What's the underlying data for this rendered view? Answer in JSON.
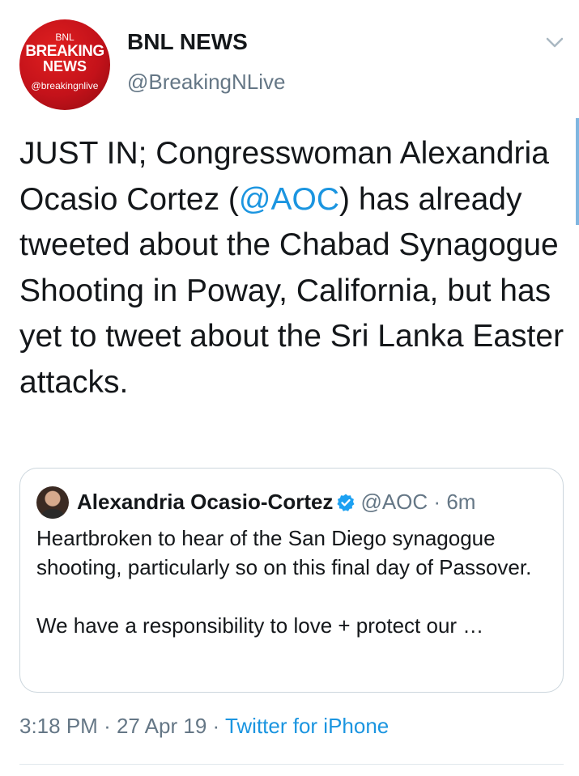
{
  "avatar": {
    "line1": "BNL",
    "line2": "BREAKING",
    "line3": "NEWS",
    "line4": "@breakingnlive",
    "color": "#c4121a"
  },
  "author": {
    "name": "BNL NEWS",
    "handle": "@BreakingNLive"
  },
  "caret_icon": "chevron-down-icon",
  "tweet": {
    "text_before": "JUST IN; Congresswoman Alexandria Ocasio Cortez (",
    "mention": "@AOC",
    "text_after": ") has already tweeted about the Chabad Synagogue Shooting in Poway, California, but has yet to tweet about the Sri Lanka Easter attacks."
  },
  "quote": {
    "name": "Alexandria Ocasio-Cortez",
    "verified_icon": "verified-badge-icon",
    "handle": "@AOC",
    "separator": "·",
    "time": "6m",
    "paragraph1": "Heartbroken to hear of the San Diego synagogue shooting, particularly so on this final day of Passover.",
    "paragraph2": "We have a responsibility to love + protect our …"
  },
  "meta": {
    "time": "3:18 PM",
    "sep1": "·",
    "date": "27 Apr 19",
    "sep2": "·",
    "client": "Twitter for iPhone"
  },
  "colors": {
    "link": "#1b95e0",
    "secondary_text": "#657786",
    "primary_text": "#14171a",
    "border": "#ccd6dd"
  }
}
